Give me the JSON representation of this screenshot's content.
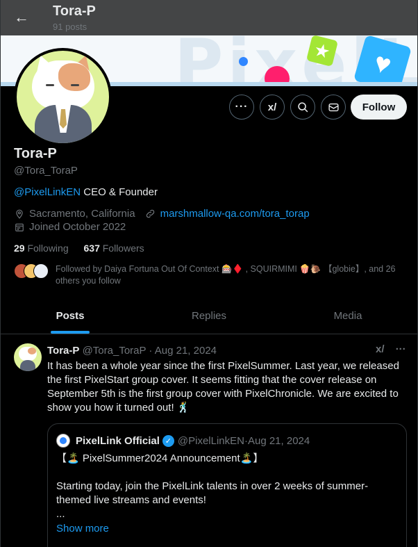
{
  "header": {
    "title": "Tora-P",
    "posts_count": "91 posts"
  },
  "profile": {
    "name": "Tora-P",
    "handle": "@Tora_ToraP",
    "bio_mention": "@PixelLinkEN",
    "bio_rest": " CEO & Founder",
    "location": "Sacramento, California",
    "website": "marshmallow-qa.com/tora_torap",
    "joined": "Joined October 2022",
    "following_count": "29",
    "following_label": " Following",
    "followers_count": "637",
    "followers_label": " Followers",
    "followed_by": "Followed by Daiya Fortuna Out Of Context 🎰♦️ , SQUIRMIMI 🍿🐌 【globie】, and 26 others you follow",
    "follow_label": "Follow"
  },
  "actions": {
    "more_icon": "more-icon",
    "grok_icon": "grok-icon",
    "search_icon": "search-icon",
    "message_icon": "message-icon"
  },
  "tabs": [
    {
      "label": "Posts",
      "active": true
    },
    {
      "label": "Replies",
      "active": false
    },
    {
      "label": "Media",
      "active": false
    }
  ],
  "post": {
    "author": "Tora-P",
    "handle": "@Tora_ToraP",
    "sep": " · ",
    "date": "Aug 21, 2024",
    "text": "It has been a whole year since the first PixelSummer. Last year, we released the first PixelStart group cover. It seems fitting that the cover release on September 5th is the first group cover with PixelChronicle. We are excited to show you how it turned out! 🕺",
    "quote": {
      "author": "PixelLink Official",
      "handle": "@PixelLinkEN",
      "date": "Aug 21, 2024",
      "line1": "【🏝️ PixelSummer2024 Announcement🏝️】",
      "line2": "Starting today, join the PixelLink talents in over 2 weeks of summer-themed live streams and events!",
      "line3": "...",
      "show_more": "Show more"
    }
  },
  "colors": {
    "accent": "#1d9bf0",
    "background": "#000000",
    "muted": "#71767b"
  }
}
